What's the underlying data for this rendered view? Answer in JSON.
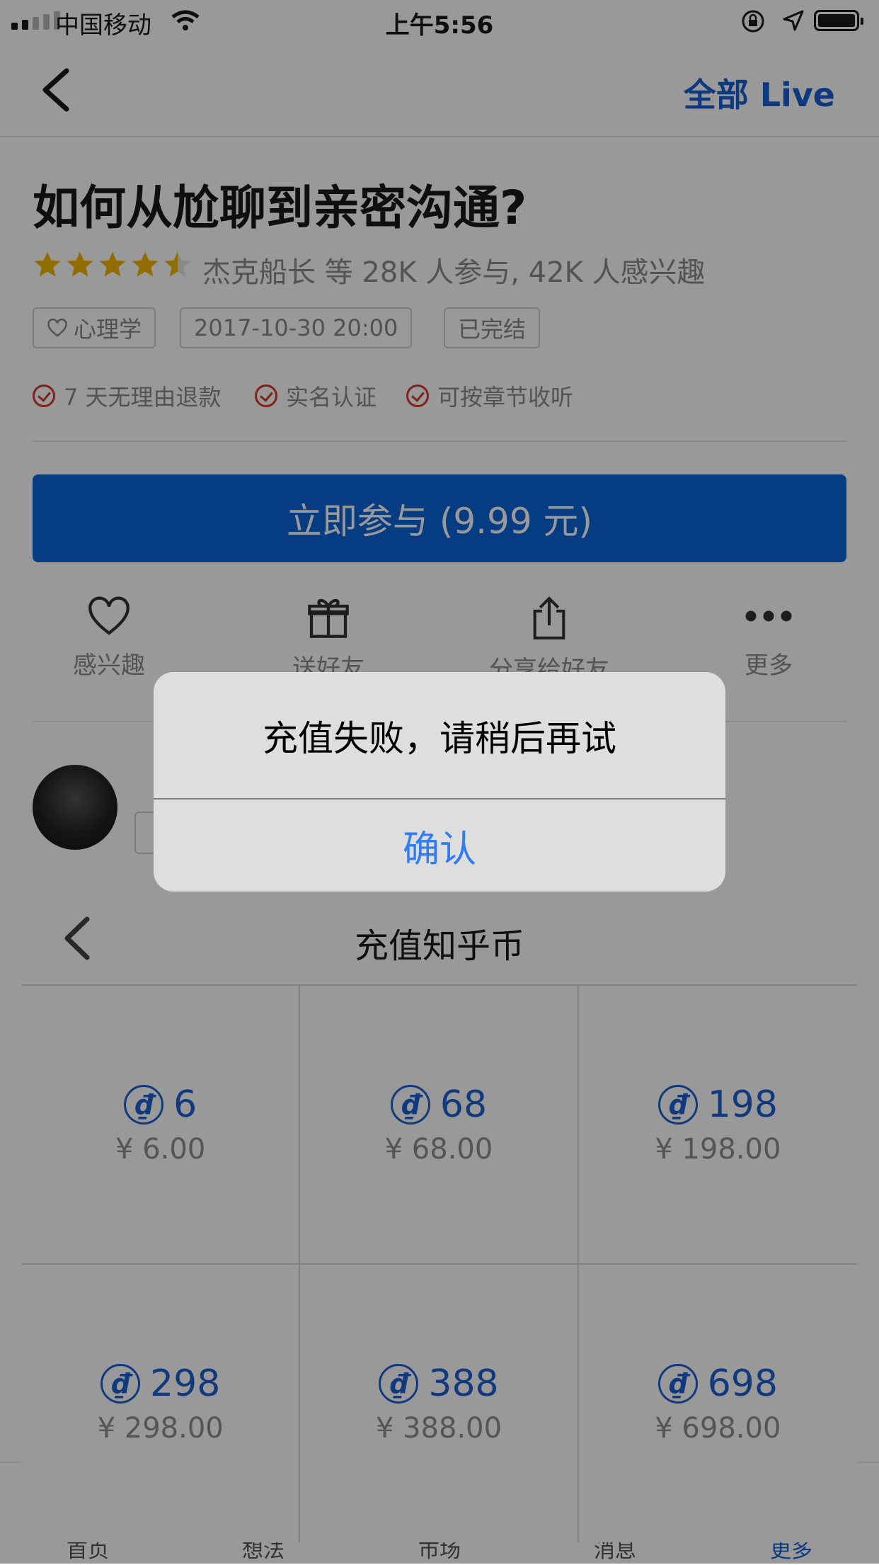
{
  "status_bar": {
    "carrier": "中国移动",
    "time": "上午5:56"
  },
  "nav": {
    "right_link": "全部 Live"
  },
  "live": {
    "title": "如何从尬聊到亲密沟通?",
    "rating": 4.5,
    "meta": "杰克船长 等 28K 人参与, 42K 人感兴趣",
    "tags": [
      "心理学",
      "2017-10-30 20:00",
      "已完结"
    ],
    "guarantees": [
      "7 天无理由退款",
      "实名认证",
      "可按章节收听"
    ],
    "join_button": "立即参与 (9.99 元)",
    "actions": [
      "感兴趣",
      "送好友",
      "分享给好友",
      "更多"
    ]
  },
  "tabbar": {
    "items": [
      "首页",
      "想法",
      "市场",
      "消息",
      "更多"
    ]
  },
  "recharge_sheet": {
    "title": "充值知乎币",
    "coin_symbol": "₫",
    "options": [
      {
        "coins": "6",
        "price": "¥ 6.00"
      },
      {
        "coins": "68",
        "price": "¥ 68.00"
      },
      {
        "coins": "198",
        "price": "¥ 198.00"
      },
      {
        "coins": "298",
        "price": "¥ 298.00"
      },
      {
        "coins": "388",
        "price": "¥ 388.00"
      },
      {
        "coins": "698",
        "price": "¥ 698.00"
      }
    ]
  },
  "alert": {
    "message": "充值失败，请稍后再试",
    "confirm": "确认"
  },
  "colors": {
    "brand_blue": "#0a64d8",
    "link_blue": "#2f7cf6",
    "coin_blue": "#1d5fd1",
    "check_red": "#d9372b",
    "star_gold": "#f2b600"
  }
}
